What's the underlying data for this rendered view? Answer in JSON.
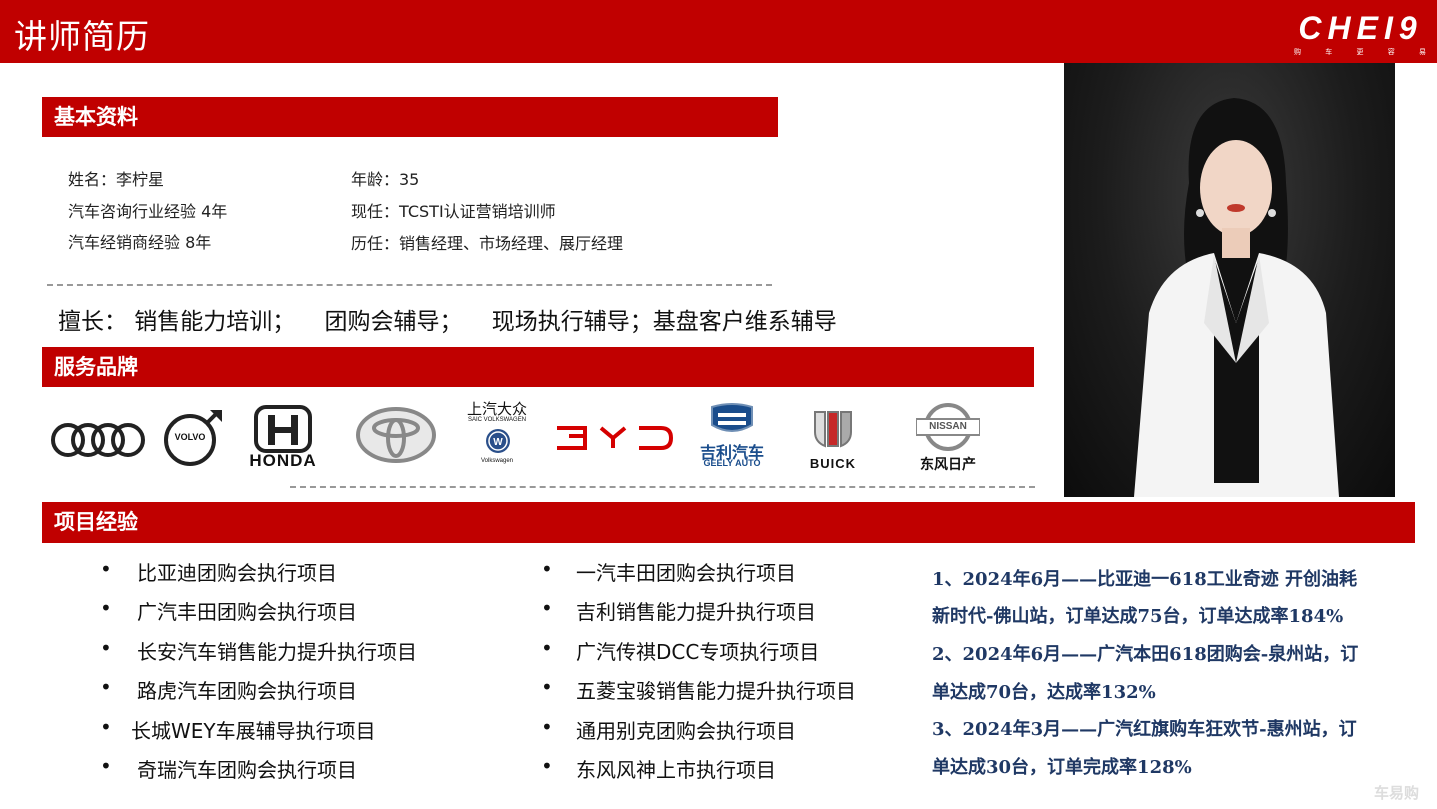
{
  "header": {
    "title": "讲师简历",
    "logo_text": "CHEI9",
    "logo_sub": [
      "购",
      "车",
      "更",
      "容",
      "易"
    ]
  },
  "basic": {
    "section_title": "基本资料",
    "left": [
      "姓名：李柠星",
      "汽车咨询行业经验 4年",
      "汽车经销商经验 8年"
    ],
    "right": [
      "年龄：35",
      "现任：TCSTI认证营销培训师",
      "历任：销售经理、市场经理、展厅经理"
    ]
  },
  "expertise": "擅长： 销售能力培训；    团购会辅导；    现场执行辅导；基盘客户维系辅导",
  "brands": {
    "section_title": "服务品牌",
    "items": [
      {
        "name": "audi-logo",
        "label": ""
      },
      {
        "name": "volvo-logo",
        "label": "VOLVO"
      },
      {
        "name": "honda-logo",
        "label": "HONDA"
      },
      {
        "name": "toyota-logo",
        "label": ""
      },
      {
        "name": "saic-volkswagen-logo",
        "label": "上汽大众",
        "sub": "SAIC VOLKSWAGEN",
        "sub2": "Volkswagen"
      },
      {
        "name": "byd-logo",
        "label": "BYD"
      },
      {
        "name": "geely-logo",
        "label": "吉利汽车",
        "sub": "GEELY AUTO"
      },
      {
        "name": "buick-logo",
        "label": "BUICK"
      },
      {
        "name": "nissan-logo",
        "label": "东风日产",
        "sub": "NISSAN"
      }
    ]
  },
  "projects": {
    "section_title": "项目经验",
    "col1": [
      "比亚迪团购会执行项目",
      "广汽丰田团购会执行项目",
      "长安汽车销售能力提升执行项目",
      "路虎汽车团购会执行项目",
      "长城WEY车展辅导执行项目",
      "奇瑞汽车团购会执行项目"
    ],
    "col2": [
      "一汽丰田团购会执行项目",
      "吉利销售能力提升执行项目",
      "广汽传祺DCC专项执行项目",
      "五菱宝骏销售能力提升执行项目",
      "通用别克团购会执行项目",
      "东风风神上市执行项目"
    ],
    "bullet": "•"
  },
  "results": [
    "1、2024年6月——比亚迪一618工业奇迹 开创油耗",
    "新时代-佛山站，订单达成75台，订单达成率184%",
    "2、2024年6月——广汽本田618团购会-泉州站，订",
    "单达成70台，达成率132%",
    "3、2024年3月——广汽红旗购车狂欢节-惠州站，订",
    "单达成30台，订单完成率128%"
  ],
  "watermark": "车易购",
  "colors": {
    "accent": "#c00000",
    "result_text": "#1f3864"
  }
}
